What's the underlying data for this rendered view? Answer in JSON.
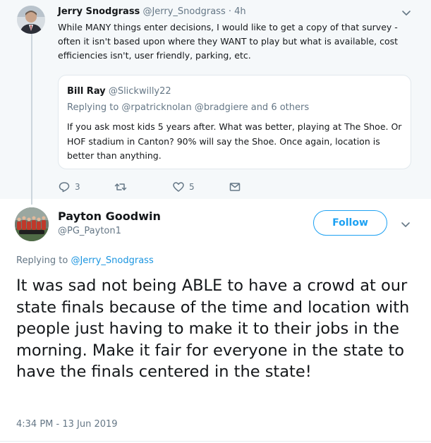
{
  "parent_tweet": {
    "author_name": "Jerry Snodgrass",
    "author_handle": "@Jerry_Snodgrass",
    "separator": "·",
    "time": "4h",
    "text": "While MANY things enter decisions, I would like to get a copy of that survey - often it isn't based upon where they WANT to play but what is available, cost efficiencies isn't, user friendly, parking, etc.",
    "quoted_tweet": {
      "author_name": "Bill Ray",
      "author_handle": "@Slickwilly22",
      "replying_to": "Replying to @rpatricknolan @bradgiere and 6 others",
      "text": "If you ask most kids 5 years after. What was better, playing at The Shoe. Or HOF stadium in Canton? 90% will say the Shoe. Once again, location is better than anything."
    },
    "actions": {
      "reply_icon": "reply-icon",
      "reply_count": "3",
      "retweet_icon": "retweet-icon",
      "retweet_count": "",
      "like_icon": "heart-icon",
      "like_count": "5",
      "message_icon": "envelope-icon"
    }
  },
  "main_tweet": {
    "author_name": "Payton Goodwin",
    "author_handle": "@PG_Payton1",
    "follow_label": "Follow",
    "replying_prefix": "Replying to",
    "replying_mention": "@Jerry_Snodgrass",
    "text": "It was sad not being ABLE to have a crowd at our state finals because of the time and location with people just having to make it to their jobs in the morning. Make it fair for everyone in the state to have the finals centered in the state!",
    "timestamp": "4:34 PM - 13 Jun 2019"
  },
  "colors": {
    "accent": "#1da1f2",
    "mention": "#1b95e0",
    "secondary_text": "#657786",
    "primary_text": "#14171a",
    "parent_background": "#f5f8fa"
  }
}
